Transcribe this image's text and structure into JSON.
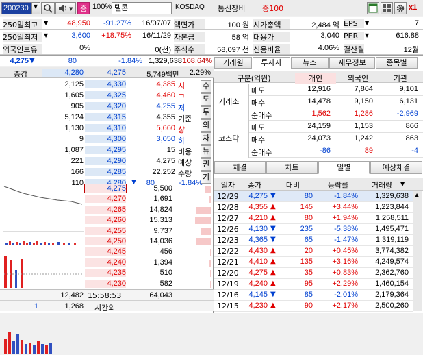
{
  "toolbar": {
    "code": "200230",
    "sound_label": "증",
    "ratio": "100%",
    "name": "텔콘",
    "market": "KOSDAQ",
    "sector": "통신장비",
    "margin": "증100",
    "x1": "x1"
  },
  "info": {
    "rows": [
      {
        "l1": "250일최고",
        "v1": "48,950",
        "p1": "-91.27%",
        "d1": "16/07/07",
        "l2": "액면가",
        "v2": "100 원",
        "l3": "시가총액",
        "v3": "2,484 억",
        "l4": "EPS",
        "v4": "7"
      },
      {
        "l1": "250일최저",
        "v1": "3,600",
        "p1": "+18.75%",
        "d1": "16/11/29",
        "l2": "자본금",
        "v2": "58 억",
        "l3": "대용가",
        "v3": "3,040",
        "l4": "PER",
        "v4": "616.88"
      },
      {
        "l1": "외국인보유",
        "v1": "0%",
        "p1": "",
        "d1": "0(천)",
        "l2": "주식수",
        "v2": "58,097 천",
        "l3": "신용비율",
        "v3": "4.06%",
        "l4": "결산월",
        "v4": "12월"
      }
    ]
  },
  "pricebar": {
    "price": "4,275",
    "arrow": "▼",
    "change": "80",
    "rate": "-1.84%",
    "volume": "1,329,638",
    "vol_rate": "108.64%"
  },
  "orderbook": {
    "header": {
      "label": "증감",
      "ask_top": "4,280",
      "price_top": "4,275",
      "amount": "5,749백만",
      "pct": "2.29%"
    },
    "asks": [
      {
        "qty": "2,125",
        "price": "4,330"
      },
      {
        "qty": "1,605",
        "price": "4,325"
      },
      {
        "qty": "905",
        "price": "4,320"
      },
      {
        "qty": "5,124",
        "price": "4,315"
      },
      {
        "qty": "1,130",
        "price": "4,310"
      },
      {
        "qty": "9",
        "price": "4,300"
      },
      {
        "qty": "1,087",
        "price": "4,295"
      },
      {
        "qty": "221",
        "price": "4,290"
      },
      {
        "qty": "166",
        "price": "4,285"
      },
      {
        "qty": "110",
        "price": "4,280"
      }
    ],
    "stats": [
      {
        "v": "4,385",
        "k": "시"
      },
      {
        "v": "4,460",
        "k": "고"
      },
      {
        "v": "4,255",
        "k": "저"
      },
      {
        "v": "4,355",
        "k": "기준"
      },
      {
        "v": "5,660",
        "k": "상"
      },
      {
        "v": "3,050",
        "k": "하"
      },
      {
        "v": "15",
        "k": "비용"
      },
      {
        "v": "4,275",
        "k": "예상"
      },
      {
        "v": "22,252",
        "k": "수량"
      }
    ],
    "stat_last": {
      "arrow": "▼",
      "v": "80",
      "rate": "-1.84%"
    },
    "vtabs": [
      "수",
      "도",
      "투",
      "외",
      "차",
      "뉴",
      "권",
      "기"
    ],
    "bids": [
      {
        "price": "4,275",
        "qty": "5,500"
      },
      {
        "price": "4,270",
        "qty": "1,691"
      },
      {
        "price": "4,265",
        "qty": "14,824"
      },
      {
        "price": "4,260",
        "qty": "15,313"
      },
      {
        "price": "4,255",
        "qty": "9,737"
      },
      {
        "price": "4,250",
        "qty": "14,036"
      },
      {
        "price": "4,245",
        "qty": "456"
      },
      {
        "price": "4,240",
        "qty": "1,394"
      },
      {
        "price": "4,235",
        "qty": "510"
      },
      {
        "price": "4,230",
        "qty": "582"
      }
    ],
    "footer": {
      "left_top": "12,482",
      "time": "15:58:53",
      "right_top": "64,043",
      "left_bottom": "1",
      "mid_bottom": "1,268",
      "label_bottom": "시간외"
    }
  },
  "right": {
    "top_tabs": [
      "거래원",
      "투자자",
      "뉴스",
      "재무정보",
      "종목별"
    ],
    "investor": {
      "headers": [
        "구분(억원)",
        "개인",
        "외국인",
        "기관"
      ],
      "groups": [
        {
          "name": "거래소",
          "rows": [
            {
              "k": "매도",
              "a": "12,916",
              "b": "7,864",
              "c": "9,101"
            },
            {
              "k": "매수",
              "a": "14,478",
              "b": "9,150",
              "c": "6,131"
            },
            {
              "k": "순매수",
              "a": "1,562",
              "b": "1,286",
              "c": "-2,969"
            }
          ]
        },
        {
          "name": "코스닥",
          "rows": [
            {
              "k": "매도",
              "a": "24,159",
              "b": "1,153",
              "c": "866"
            },
            {
              "k": "매수",
              "a": "24,073",
              "b": "1,242",
              "c": "863"
            },
            {
              "k": "순매수",
              "a": "-86",
              "b": "89",
              "c": "-4"
            }
          ]
        }
      ]
    },
    "bottom_tabs": [
      "체결",
      "차트",
      "일별",
      "예상체결"
    ],
    "daily": {
      "headers": [
        "일자",
        "종가",
        "대비",
        "등락률",
        "거래량"
      ],
      "rows": [
        {
          "d": "12/29",
          "c": "4,275",
          "a": "▼",
          "diff": "80",
          "r": "-1.84%",
          "v": "1,329,638"
        },
        {
          "d": "12/28",
          "c": "4,355",
          "a": "▲",
          "diff": "145",
          "r": "+3.44%",
          "v": "1,223,844"
        },
        {
          "d": "12/27",
          "c": "4,210",
          "a": "▲",
          "diff": "80",
          "r": "+1.94%",
          "v": "1,258,511"
        },
        {
          "d": "12/26",
          "c": "4,130",
          "a": "▼",
          "diff": "235",
          "r": "-5.38%",
          "v": "1,495,471"
        },
        {
          "d": "12/23",
          "c": "4,365",
          "a": "▼",
          "diff": "65",
          "r": "-1.47%",
          "v": "1,319,119"
        },
        {
          "d": "12/22",
          "c": "4,430",
          "a": "▲",
          "diff": "20",
          "r": "+0.45%",
          "v": "3,774,382"
        },
        {
          "d": "12/21",
          "c": "4,410",
          "a": "▲",
          "diff": "135",
          "r": "+3.16%",
          "v": "4,249,574"
        },
        {
          "d": "12/20",
          "c": "4,275",
          "a": "▲",
          "diff": "35",
          "r": "+0.83%",
          "v": "2,362,760"
        },
        {
          "d": "12/19",
          "c": "4,240",
          "a": "▲",
          "diff": "95",
          "r": "+2.29%",
          "v": "1,460,154"
        },
        {
          "d": "12/16",
          "c": "4,145",
          "a": "▼",
          "diff": "85",
          "r": "-2.01%",
          "v": "2,179,364"
        },
        {
          "d": "12/15",
          "c": "4,230",
          "a": "▲",
          "diff": "90",
          "r": "+2.17%",
          "v": "2,500,260"
        }
      ]
    }
  },
  "colors": {
    "up": "#e00000",
    "down": "#0040d0",
    "ask_bg": "#dce8f6",
    "bid_bg": "#fbe3e3"
  }
}
